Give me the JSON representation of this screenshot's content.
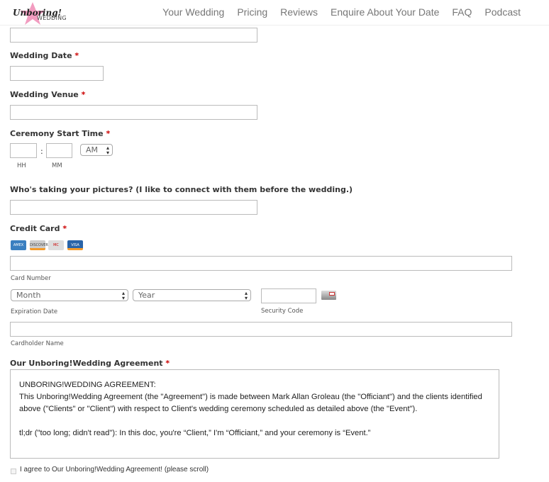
{
  "brand": {
    "logo_text": "Unboring!",
    "logo_sub": "WEDDING",
    "star_color": "#f29cc0"
  },
  "nav": [
    "Your Wedding",
    "Pricing",
    "Reviews",
    "Enquire About Your Date",
    "FAQ",
    "Podcast"
  ],
  "fields": {
    "wedding_date": "Wedding Date",
    "wedding_venue": "Wedding Venue",
    "ceremony_time": "Ceremony Start Time",
    "hh": "HH",
    "mm": "MM",
    "colon": ":",
    "ampm": "AM",
    "photographer": "Who's taking your pictures? (I like to connect with them before the wedding.)",
    "credit_card": "Credit Card",
    "card_number": "Card Number",
    "month": "Month",
    "year": "Year",
    "expiration": "Expiration Date",
    "security": "Security Code",
    "cardholder": "Cardholder Name",
    "agreement": "Our Unboring!Wedding Agreement",
    "required": "*"
  },
  "cards": [
    "AMEX",
    "DISCOVER",
    "MC",
    "VISA"
  ],
  "agreement": {
    "heading": "UNBORING!WEDDING AGREEMENT:",
    "p1": "This Unboring!Wedding Agreement (the \"Agreement\") is made between Mark Allan Groleau (the \"Officiant\") and the clients identified above (\"Clients\" or \"Client\") with respect to Client's wedding ceremony scheduled as detailed above (the \"Event\").",
    "p2": "tl;dr (\"too long; didn't read\"): In this doc, you're “Client,” I'm “Officiant,” and your ceremony is “Event.”"
  },
  "agree_label": "I agree to Our Unboring!Wedding Agreement! (please scroll)"
}
